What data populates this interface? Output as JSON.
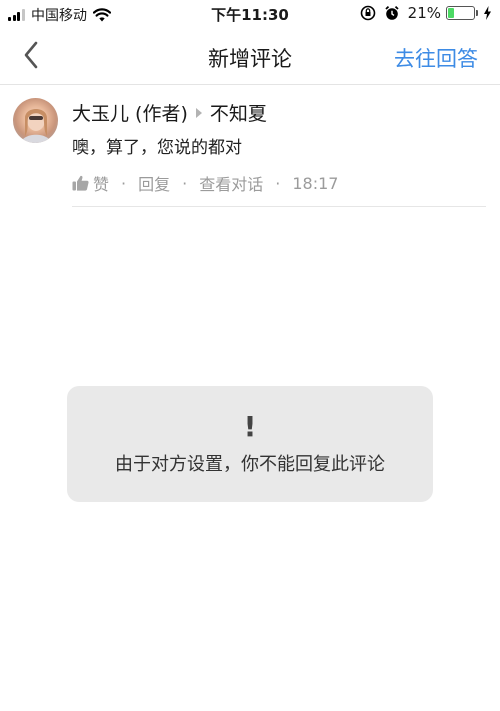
{
  "status_bar": {
    "carrier": "中国移动",
    "time": "下午11:30",
    "battery_percent": "21%",
    "battery_level": 0.21,
    "icons": [
      "signal-icon",
      "wifi-icon",
      "orientation-lock-icon",
      "alarm-icon",
      "battery-icon",
      "charging-icon"
    ]
  },
  "nav": {
    "back_icon": "chevron-left-icon",
    "title": "新增评论",
    "action": "去往回答",
    "action_color": "#3d8be5"
  },
  "comment": {
    "author": "大玉儿 (作者)",
    "reply_to": "不知夏",
    "text": "噢，算了，您说的都对",
    "like_label": "赞",
    "reply_label": "回复",
    "view_conversation_label": "查看对话",
    "separator": "·",
    "time": "18:17"
  },
  "toast": {
    "icon": "!",
    "message": "由于对方设置，你不能回复此评论"
  }
}
